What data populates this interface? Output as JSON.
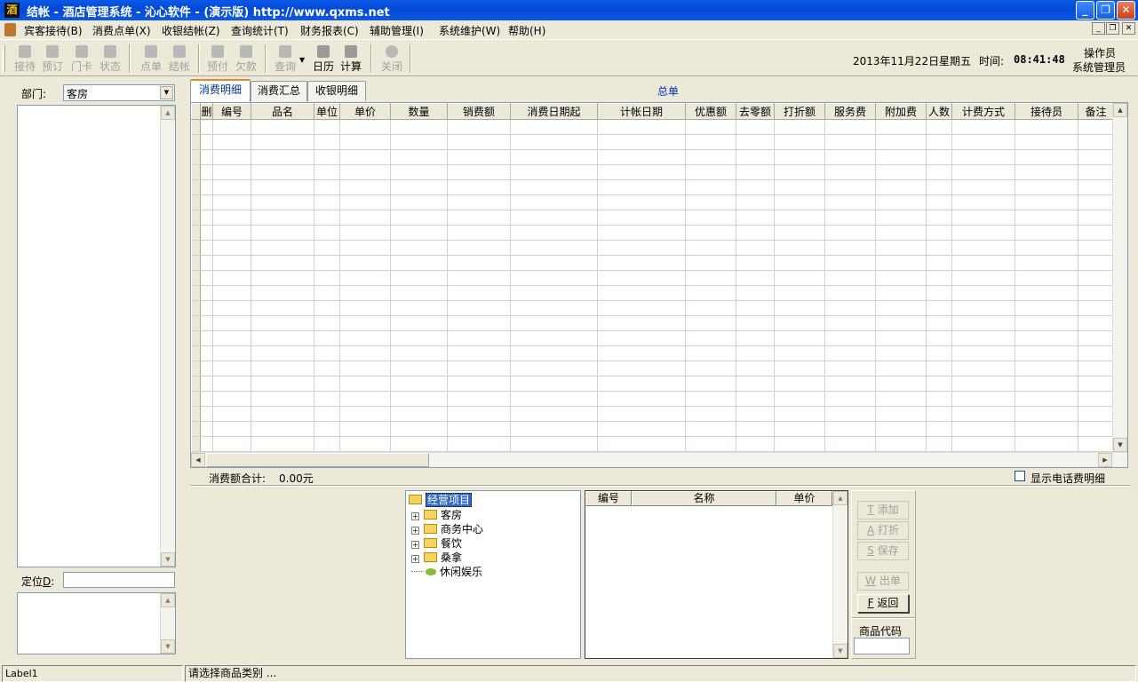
{
  "window": {
    "title": "结帐 - 酒店管理系统 - 沁心软件 - (演示版) http://www.qxms.net",
    "app_icon": "酒",
    "controls": {
      "minimize": "_",
      "restore": "❐",
      "close": "✕"
    }
  },
  "menu": {
    "items": [
      "宾客接待(B)",
      "消费点单(X)",
      "收银结帐(Z)",
      "查询统计(T)",
      "财务报表(C)",
      "辅助管理(I)",
      "系统维护(W)",
      "帮助(H)"
    ],
    "mdi_controls": {
      "minimize": "_",
      "restore": "❐",
      "close": "✕"
    }
  },
  "toolbar": {
    "buttons": [
      {
        "label": "接待",
        "icon": "reception-icon",
        "enabled": false
      },
      {
        "label": "预订",
        "icon": "reservation-icon",
        "enabled": false
      },
      {
        "label": "门卡",
        "icon": "door-card-icon",
        "enabled": false
      },
      {
        "label": "状态",
        "icon": "status-icon",
        "enabled": false
      },
      {
        "label": "点单",
        "icon": "order-icon",
        "enabled": false
      },
      {
        "label": "结帐",
        "icon": "checkout-icon",
        "enabled": false
      },
      {
        "label": "预付",
        "icon": "prepay-icon",
        "enabled": false
      },
      {
        "label": "欠款",
        "icon": "debt-icon",
        "enabled": false
      },
      {
        "label": "查询",
        "icon": "query-icon",
        "enabled": false
      },
      {
        "label": "日历",
        "icon": "calendar-icon",
        "enabled": true
      },
      {
        "label": "计算",
        "icon": "calculator-icon",
        "enabled": true
      },
      {
        "label": "关闭",
        "icon": "power-icon",
        "enabled": false
      }
    ],
    "date": "2013年11月22日",
    "weekday": "星期五",
    "time_label": "时间:",
    "time_value": "08:41:48",
    "operator_label": "操作员",
    "operator_value": "系统管理员"
  },
  "left_panel": {
    "dept_label": "部门:",
    "dept_value": "客房",
    "locate_label": "定位",
    "locate_key": "D",
    "locate_suffix": ":",
    "locate_value": ""
  },
  "tabs": [
    "消费明细",
    "消费汇总",
    "收银明细"
  ],
  "active_tab": 0,
  "summary_title": "总单",
  "grid": {
    "columns": [
      "删",
      "编号",
      "品名",
      "单位",
      "单价",
      "数量",
      "销费额",
      "消费日期起",
      "计帐日期",
      "优惠额",
      "去零额",
      "打折额",
      "服务费",
      "附加费",
      "人数",
      "计费方式",
      "接待员",
      "备注"
    ],
    "rows": []
  },
  "totals": {
    "label": "消费额合计:",
    "value": "0.00元",
    "show_phone_label": "显示电话费明细",
    "show_phone_checked": false
  },
  "tree": {
    "root": "经营项目",
    "children": [
      {
        "label": "客房",
        "expandable": true
      },
      {
        "label": "商务中心",
        "expandable": true
      },
      {
        "label": "餐饮",
        "expandable": true
      },
      {
        "label": "桑拿",
        "expandable": true
      },
      {
        "label": "休闲娱乐",
        "expandable": false
      }
    ]
  },
  "product_list": {
    "columns": [
      "编号",
      "名称",
      "单价"
    ],
    "rows": []
  },
  "actions": {
    "add": {
      "key": "T",
      "label": "添加",
      "enabled": false
    },
    "open": {
      "key": "A",
      "label": "打折",
      "enabled": false
    },
    "save": {
      "key": "S",
      "label": "保存",
      "enabled": false
    },
    "out": {
      "key": "W",
      "label": "出单",
      "enabled": false
    },
    "back": {
      "key": "F",
      "label": "返回",
      "enabled": true
    },
    "product_code_label": "商品代码",
    "product_code_value": ""
  },
  "statusbar": {
    "left": "Label1",
    "message": "请选择商品类别 ..."
  }
}
